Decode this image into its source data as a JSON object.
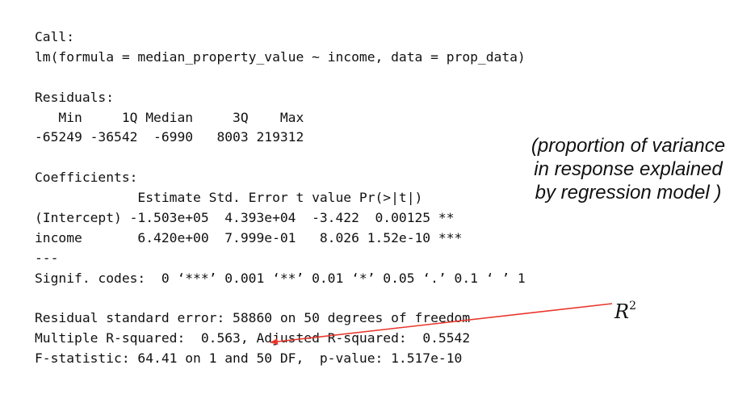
{
  "r_output": {
    "lines": [
      "Call:",
      "lm(formula = median_property_value ~ income, data = prop_data)",
      "",
      "Residuals:",
      "   Min     1Q Median     3Q    Max",
      "-65249 -36542  -6990   8003 219312",
      "",
      "Coefficients:",
      "             Estimate Std. Error t value Pr(>|t|)",
      "(Intercept) -1.503e+05  4.393e+04  -3.422  0.00125 **",
      "income       6.420e+00  7.999e-01   8.026 1.52e-10 ***",
      "---",
      "Signif. codes:  0 ‘***’ 0.001 ‘**’ 0.01 ‘*’ 0.05 ‘.’ 0.1 ‘ ’ 1",
      "",
      "Residual standard error: 58860 on 50 degrees of freedom",
      "Multiple R-squared:  0.563,\tAdjusted R-squared:  0.5542",
      "F-statistic: 64.41 on 1 and 50 DF,  p-value: 1.517e-10"
    ]
  },
  "annotation": {
    "lines": [
      "(proportion of variance",
      "in response explained",
      "by regression model )"
    ]
  },
  "r2_label": {
    "base": "R",
    "exponent": "2"
  },
  "colors": {
    "arrow": "#e8372c",
    "text": "#111111"
  }
}
